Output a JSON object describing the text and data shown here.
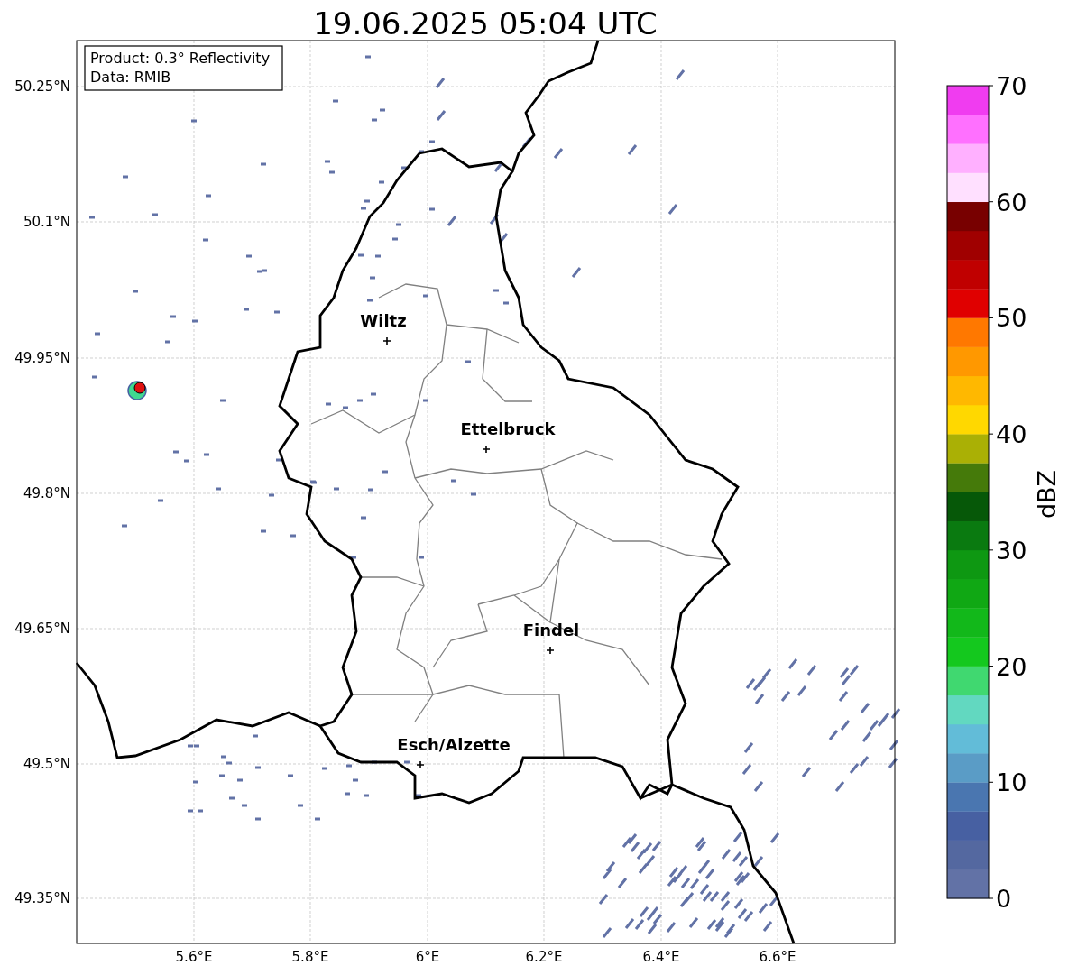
{
  "title": "19.06.2025 05:04 UTC",
  "info_box": [
    "Product: 0.3° Reflectivity",
    "Data: RMIB"
  ],
  "y_ticks": [
    "50.25°N",
    "50.1°N",
    "49.95°N",
    "49.8°N",
    "49.65°N",
    "49.5°N",
    "49.35°N"
  ],
  "x_ticks": [
    "5.6°E",
    "5.8°E",
    "6°E",
    "6.2°E",
    "6.4°E",
    "6.6°E"
  ],
  "cities": [
    {
      "name": "Wiltz"
    },
    {
      "name": "Ettelbruck"
    },
    {
      "name": "Findel"
    },
    {
      "name": "Esch/Alzette"
    }
  ],
  "colorbar": {
    "label": "dBZ",
    "ticks": [
      "70",
      "60",
      "50",
      "40",
      "30",
      "20",
      "10",
      "0"
    ],
    "bins": [
      {
        "color": "#6272a6"
      },
      {
        "color": "#5468a0"
      },
      {
        "color": "#4760a2"
      },
      {
        "color": "#4a76b0"
      },
      {
        "color": "#5a9cc6"
      },
      {
        "color": "#62bcd8"
      },
      {
        "color": "#62d8c0"
      },
      {
        "color": "#40d870"
      },
      {
        "color": "#14c81e"
      },
      {
        "color": "#12b81a"
      },
      {
        "color": "#10a814"
      },
      {
        "color": "#0e9812"
      },
      {
        "color": "#0a7a10"
      },
      {
        "color": "#065808"
      },
      {
        "color": "#457a0a"
      },
      {
        "color": "#aab005"
      },
      {
        "color": "#ffd800"
      },
      {
        "color": "#ffb800"
      },
      {
        "color": "#ff9800"
      },
      {
        "color": "#ff7800"
      },
      {
        "color": "#e00000"
      },
      {
        "color": "#c00000"
      },
      {
        "color": "#a00000"
      },
      {
        "color": "#780000"
      },
      {
        "color": "#ffe0ff"
      },
      {
        "color": "#ffb0ff"
      },
      {
        "color": "#ff70ff"
      },
      {
        "color": "#f03cf0"
      }
    ]
  }
}
